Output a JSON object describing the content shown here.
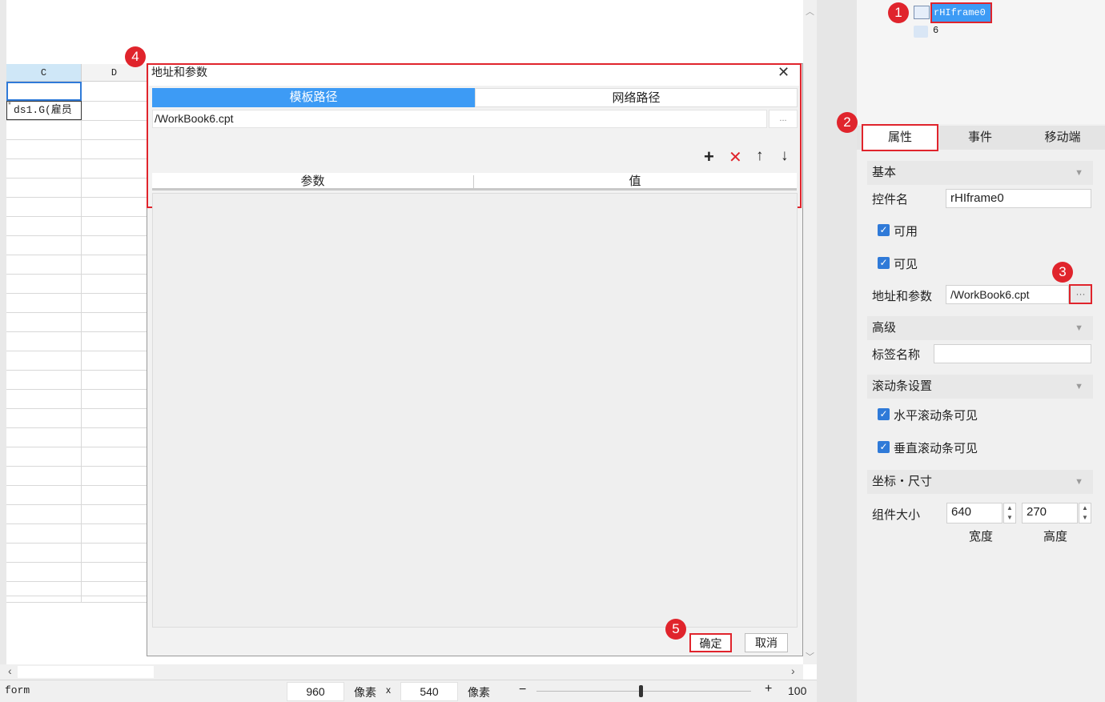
{
  "sheet": {
    "columns": [
      "C",
      "D"
    ],
    "cell_c2": "ds1.G(雇员"
  },
  "status": {
    "mode": "form",
    "width": "960",
    "unit1": "像素",
    "times": "x",
    "height": "540",
    "unit2": "像素",
    "zoom": "100"
  },
  "dialog": {
    "title": "地址和参数",
    "tabs": [
      "模板路径",
      "网络路径"
    ],
    "path_value": "/WorkBook6.cpt",
    "browse_label": "...",
    "toolbar": {
      "add": "+",
      "delete": "✕",
      "up": "↑",
      "down": "↓"
    },
    "table_headers": [
      "参数",
      "值"
    ],
    "ok": "确定",
    "cancel": "取消"
  },
  "tree": {
    "selected": "rHIframe0",
    "second": "6"
  },
  "panel": {
    "tabs": [
      "属性",
      "事件",
      "移动端"
    ],
    "basic_section": "基本",
    "control_name_label": "控件名",
    "control_name_value": "rHIframe0",
    "enabled_label": "可用",
    "visible_label": "可见",
    "address_label": "地址和参数",
    "address_value": "/WorkBook6.cpt",
    "address_browse": "···",
    "advanced_section": "高级",
    "tag_label": "标签名称",
    "tag_value": "",
    "scroll_section": "滚动条设置",
    "hscroll_label": "水平滚动条可见",
    "vscroll_label": "垂直滚动条可见",
    "coord_section": "坐标・尺寸",
    "size_label": "组件大小",
    "width_value": "640",
    "height_value": "270",
    "width_caption": "宽度",
    "height_caption": "高度"
  },
  "badges": [
    "1",
    "2",
    "3",
    "4",
    "5"
  ],
  "colors": {
    "accent": "#3d9bf5",
    "highlight": "#e0242c",
    "check": "#2f7ad8"
  }
}
